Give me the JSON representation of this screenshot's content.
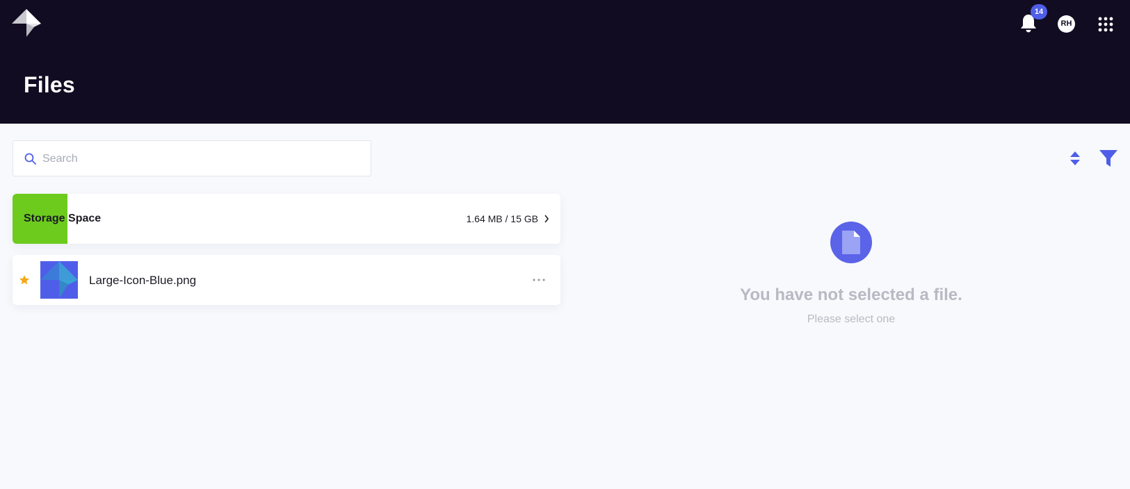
{
  "header": {
    "page_title": "Files",
    "notifications": {
      "count": "14",
      "icon": "bell-icon"
    },
    "user": {
      "initials": "RH"
    },
    "apps_icon": "grid-icon",
    "colors": {
      "background": "#110c21",
      "accent": "#4f5ee8"
    }
  },
  "search": {
    "placeholder": "Search",
    "value": ""
  },
  "toolbar": {
    "sort_icon": "sort-icon",
    "filter_icon": "filter-icon"
  },
  "storage": {
    "label": "Storage Space",
    "used": "1.64 MB",
    "total": "15 GB",
    "usage_text": "1.64 MB / 15 GB",
    "fill_fraction": 0.1,
    "fill_color": "#6dcb1e"
  },
  "files": [
    {
      "name": "Large-Icon-Blue.png",
      "starred": true,
      "thumb_color": "#4f5ee8"
    }
  ],
  "empty_state": {
    "title": "You have not selected a file.",
    "subtitle": "Please select one"
  }
}
